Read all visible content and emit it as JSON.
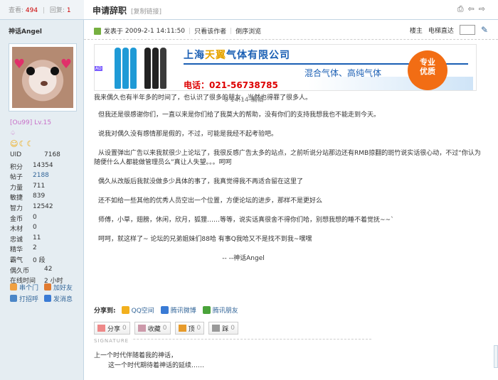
{
  "stats": {
    "views_label": "查看:",
    "views": "494",
    "sep": "|",
    "replies_label": "回复:",
    "replies": "1"
  },
  "thread": {
    "title": "申请辞职",
    "copy_link": "[复制链接]"
  },
  "author": {
    "name": "神话Angel",
    "level": "[Ou99] Lv.15",
    "level_extra": "♤",
    "medals": "☺☾☾",
    "profile": [
      {
        "key": "UID",
        "value": "7168"
      },
      {
        "key": "积分",
        "value": "14354"
      },
      {
        "key": "帖子",
        "value": "2188",
        "link": true
      },
      {
        "key": "力量",
        "value": "711"
      },
      {
        "key": "敏捷",
        "value": "839"
      },
      {
        "key": "智力",
        "value": "12542"
      },
      {
        "key": "金币",
        "value": "0"
      },
      {
        "key": "木材",
        "value": "0"
      },
      {
        "key": "忠诚",
        "value": "11"
      },
      {
        "key": "精华",
        "value": "2"
      },
      {
        "key": "霸气",
        "value": "0 段"
      },
      {
        "key": "偶久币",
        "value": "42"
      },
      {
        "key": "在线时间",
        "value": "2 小时"
      }
    ],
    "actions": [
      {
        "label": "串个门",
        "color": "#f0a040"
      },
      {
        "label": "加好友",
        "color": "#e07a30"
      },
      {
        "label": "打招呼",
        "color": "#4b86c7"
      },
      {
        "label": "发消息",
        "color": "#3a7bd5"
      }
    ]
  },
  "post": {
    "posted_at_label": "发表于",
    "posted_at": "2009-2-1 14:11:50",
    "only_author": "只看该作者",
    "reverse": "倒序浏览",
    "floor": "楼主",
    "floor_jump": "电梯直达",
    "edited_note": "8 14:14 编辑",
    "first_line": "我来偶久也有半年多的时间了，也认识了很多的朋友，当然也得罪了很多人。",
    "paragraphs": [
      "但我还是很感谢你们，一直以来是你们给了我莫大的帮助，没有你们的支持我想我也不能走到今天。",
      "说我对偶久没有感情那是假的，不过，可能是我经不起考验吧。",
      "从设置弹出广告以来我就很少上论坛了，我很反感广告太多的站点，之前听说分站那边还有RMB掠翻的斑竹说实话很心动，不过“你认为随便什么人都能做管理员么”真让人失望。。。呵呵",
      "偶久从改版后我就没做多少具体的事了，我真觉得我不再适合留在这里了",
      "还不如给一些其他的优秀人员空出一个位置，方便论坛的进步，那样不是更好么",
      "师傅，小草，翅膀，休闲，欣月，狐狸……等等，说实话真很舍不得你们哈，别想我想的睡不着觉抚~~`",
      "呵呵，就这样了~ 论坛的兄弟姐妹们88哈 有事Q我哈又不是找不到我~嘿嘿"
    ],
    "signoff": "-- --神话Angel"
  },
  "banner": {
    "tag": "AD",
    "company_a": "上海",
    "company_hl": "天翼",
    "company_b": "气体有限公司",
    "subtitle": "混合气体、高纯气体",
    "phone": "电话：021-56738785",
    "badge": "专业\n优质"
  },
  "share": {
    "label": "分享到:",
    "items": [
      {
        "label": "QQ空间",
        "color": "#f2b01e"
      },
      {
        "label": "腾讯微博",
        "color": "#3a7bd5"
      },
      {
        "label": "腾讯朋友",
        "color": "#4aa33a"
      }
    ]
  },
  "buttons": [
    {
      "label": "分享",
      "count": "0",
      "color": "#e88"
    },
    {
      "label": "收藏",
      "count": "0",
      "color": "#c9a"
    },
    {
      "label": "顶",
      "count": "0",
      "color": "#e79b2b"
    },
    {
      "label": "踩",
      "count": "0",
      "color": "#999"
    }
  ],
  "signature": {
    "label": "SIGNATURE",
    "line1": "上一个时代伴随着我的神话，",
    "line2": "这一个时代期待着神话的延续……"
  }
}
